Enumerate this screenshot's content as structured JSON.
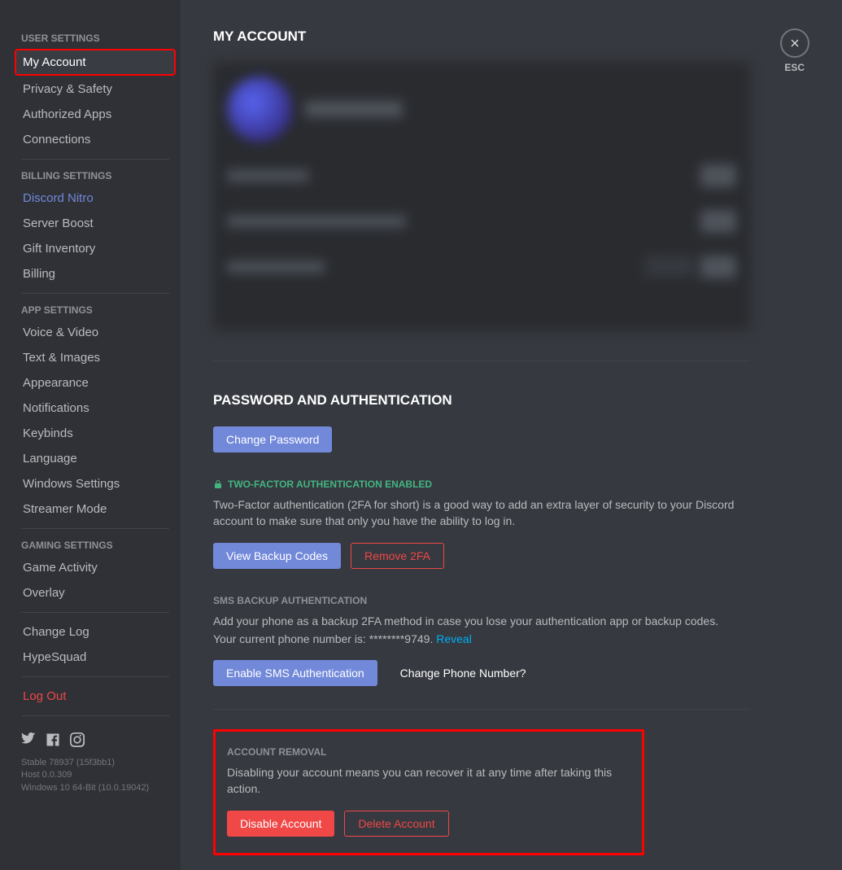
{
  "sidebar": {
    "sections": [
      {
        "header": "USER SETTINGS",
        "items": [
          {
            "label": "My Account",
            "selected": true
          },
          {
            "label": "Privacy & Safety"
          },
          {
            "label": "Authorized Apps"
          },
          {
            "label": "Connections"
          }
        ]
      },
      {
        "header": "BILLING SETTINGS",
        "items": [
          {
            "label": "Discord Nitro",
            "nitro": true
          },
          {
            "label": "Server Boost"
          },
          {
            "label": "Gift Inventory"
          },
          {
            "label": "Billing"
          }
        ]
      },
      {
        "header": "APP SETTINGS",
        "items": [
          {
            "label": "Voice & Video"
          },
          {
            "label": "Text & Images"
          },
          {
            "label": "Appearance"
          },
          {
            "label": "Notifications"
          },
          {
            "label": "Keybinds"
          },
          {
            "label": "Language"
          },
          {
            "label": "Windows Settings"
          },
          {
            "label": "Streamer Mode"
          }
        ]
      },
      {
        "header": "GAMING SETTINGS",
        "items": [
          {
            "label": "Game Activity"
          },
          {
            "label": "Overlay"
          }
        ]
      }
    ],
    "extra": {
      "change_log": "Change Log",
      "hypesquad": "HypeSquad",
      "logout": "Log Out"
    },
    "build": {
      "line1": "Stable 78937 (15f3bb1)",
      "line2": "Host 0.0.309",
      "line3": "Windows 10 64-Bit (10.0.19042)"
    }
  },
  "close_label": "ESC",
  "page_title": "MY ACCOUNT",
  "password_section": {
    "title": "PASSWORD AND AUTHENTICATION",
    "change_password": "Change Password"
  },
  "tfa": {
    "title": "TWO-FACTOR AUTHENTICATION ENABLED",
    "description": "Two-Factor authentication (2FA for short) is a good way to add an extra layer of security to your Discord account to make sure that only you have the ability to log in.",
    "view_backup": "View Backup Codes",
    "remove": "Remove 2FA"
  },
  "sms": {
    "title": "SMS BACKUP AUTHENTICATION",
    "description": "Add your phone as a backup 2FA method in case you lose your authentication app or backup codes.",
    "current_prefix": "Your current phone number is: ",
    "masked_number": "********9749.",
    "reveal": "Reveal",
    "enable": "Enable SMS Authentication",
    "change_phone": "Change Phone Number?"
  },
  "removal": {
    "title": "ACCOUNT REMOVAL",
    "description": "Disabling your account means you can recover it at any time after taking this action.",
    "disable": "Disable Account",
    "delete": "Delete Account"
  }
}
